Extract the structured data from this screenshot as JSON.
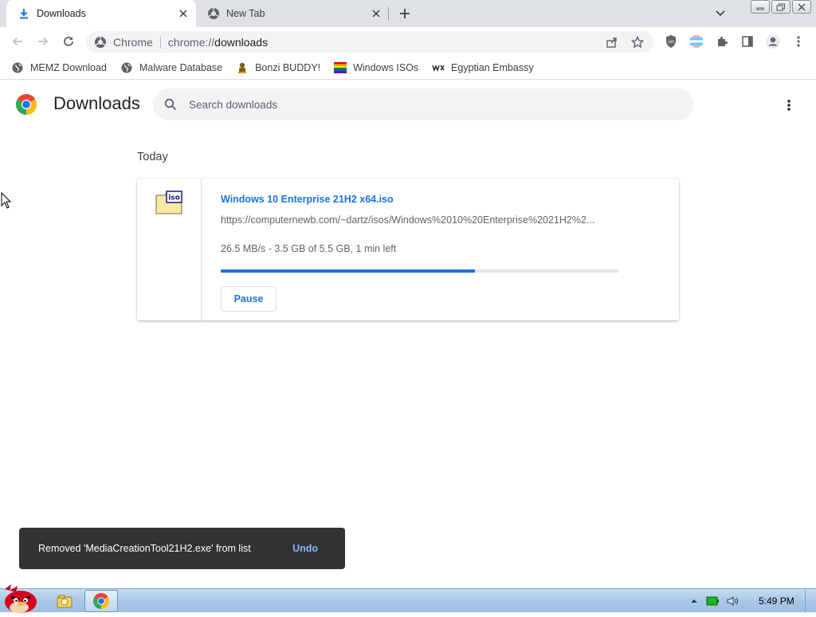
{
  "tabs": [
    {
      "label": "Downloads",
      "icon": "download-icon",
      "active": true
    },
    {
      "label": "New Tab",
      "icon": "chrome-globe-icon",
      "active": false
    }
  ],
  "omnibox": {
    "chip": "Chrome",
    "url_scheme": "chrome://",
    "url_path": "downloads"
  },
  "bookmarks": [
    {
      "label": "MEMZ Download",
      "icon": "globe-icon"
    },
    {
      "label": "Malware Database",
      "icon": "globe-icon"
    },
    {
      "label": "Bonzi BUDDY!",
      "icon": "bonzi-icon"
    },
    {
      "label": "Windows ISOs",
      "icon": "rainbow-flag-icon"
    },
    {
      "label": "Egyptian Embassy",
      "icon": "wix-icon"
    }
  ],
  "page": {
    "title": "Downloads",
    "search_placeholder": "Search downloads",
    "date_heading": "Today"
  },
  "download": {
    "file_name": "Windows 10 Enterprise 21H2 x64.iso",
    "url": "https://computernewb.com/~dartz/isos/Windows%2010%20Enterprise%2021H2%2...",
    "status": "26.5 MB/s - 3.5 GB of 5.5 GB, 1 min left",
    "progress_fraction": 0.64,
    "pause_label": "Pause",
    "icon_label": "ISO"
  },
  "toast": {
    "message": "Removed 'MediaCreationTool21H2.exe' from list",
    "undo_label": "Undo"
  },
  "taskbar": {
    "clock": "5:49 PM"
  },
  "colors": {
    "accent": "#1a73e8",
    "tabstrip": "#dee1e6",
    "toast_bg": "#323232",
    "undo": "#8ab4f8"
  }
}
